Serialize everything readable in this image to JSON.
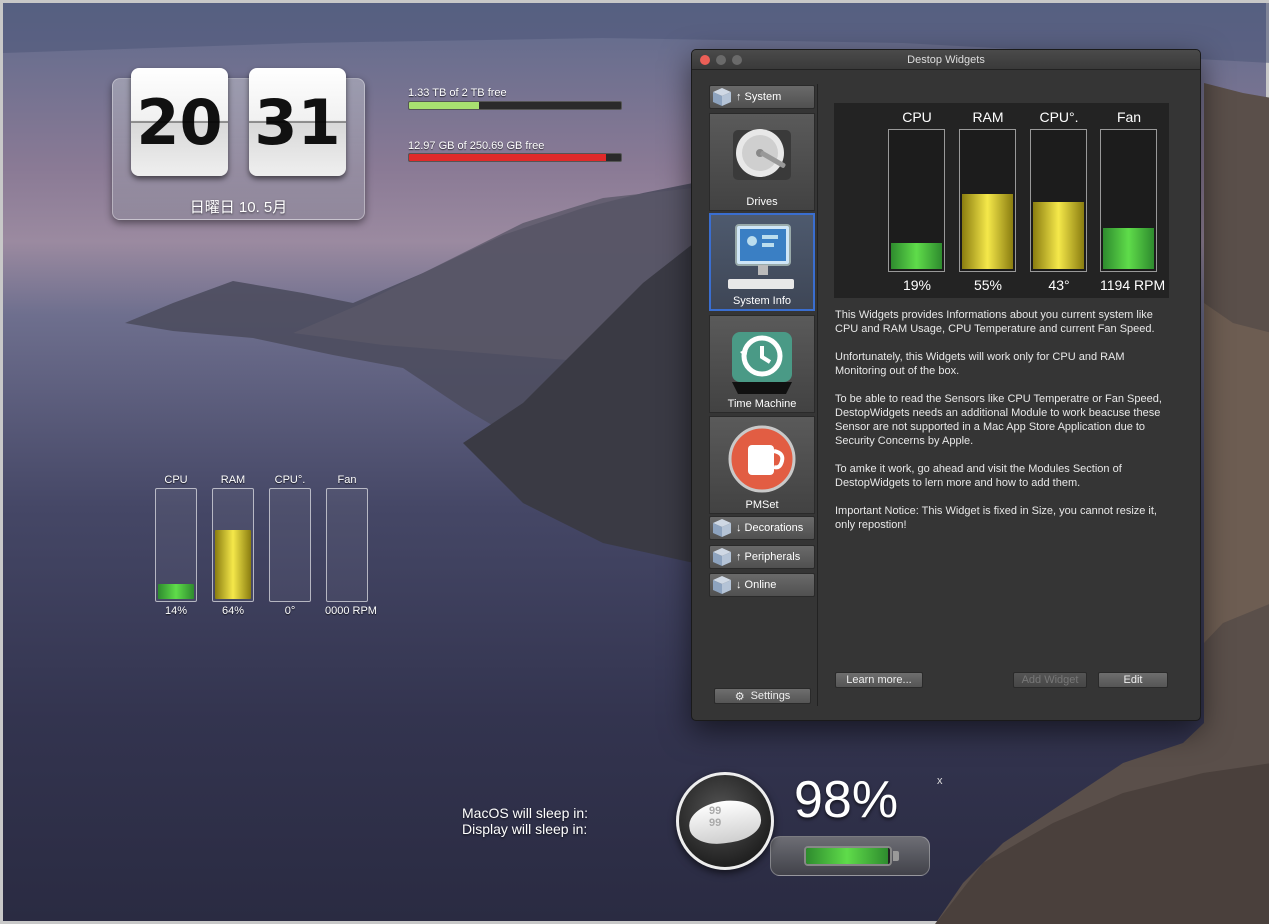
{
  "clock": {
    "hour": "20",
    "minute": "31",
    "date": "日曜日 10. 5月"
  },
  "drives": [
    {
      "label": "1.33 TB of 2 TB free",
      "fraction": 0.33,
      "color": "#a8e070"
    },
    {
      "label": "12.97 GB of 250.69 GB free",
      "fraction": 0.93,
      "color": "#e02a2a"
    }
  ],
  "desktop_widget": {
    "columns": [
      {
        "title": "CPU",
        "value": "14%",
        "level": 0.14,
        "style": "green"
      },
      {
        "title": "RAM",
        "value": "64%",
        "level": 0.64,
        "style": "yellow"
      },
      {
        "title": "CPU°.",
        "value": "0°",
        "level": 0,
        "style": "yellow"
      },
      {
        "title": "Fan",
        "value": "0000 RPM",
        "level": 0,
        "style": "green"
      }
    ]
  },
  "sleep": {
    "macos_label": "MacOS will sleep in:",
    "display_label": "Display will sleep in:"
  },
  "battery": {
    "percent": "98%",
    "level": 0.98,
    "close_label": "x",
    "mouse_digits_top": "99",
    "mouse_digits_bottom": "99"
  },
  "window": {
    "title": "Destop Widgets",
    "sidebar": {
      "group_system": "↑ System",
      "tiles": [
        {
          "label": "Drives",
          "icon": "hard-drive-icon"
        },
        {
          "label": "System Info",
          "icon": "system-info-icon"
        },
        {
          "label": "Time Machine",
          "icon": "time-machine-icon"
        },
        {
          "label": "PMSet",
          "icon": "coffee-cup-icon"
        }
      ],
      "group_decorations": "↓ Decorations",
      "group_peripherals": "↑ Peripherals",
      "group_online": "↓ Online",
      "settings": "Settings"
    },
    "preview": {
      "columns": [
        {
          "title": "CPU",
          "value": "19%",
          "level": 0.19,
          "style": "green"
        },
        {
          "title": "RAM",
          "value": "55%",
          "level": 0.55,
          "style": "yellow"
        },
        {
          "title": "CPU°.",
          "value": "43°",
          "level": 0.49,
          "style": "yellow"
        },
        {
          "title": "Fan",
          "value": "1194 RPM",
          "level": 0.3,
          "style": "green"
        }
      ]
    },
    "description": [
      "This Widgets provides Informations about you current system like CPU and RAM Usage, CPU Temperature and current Fan Speed.",
      "Unfortunately, this Widgets will work only for CPU and RAM Monitoring out of the box.",
      "To be able to read the Sensors like CPU Temperatre or Fan Speed, DestopWidgets needs an additional Module to work beacuse these Sensor are not supported in a Mac App Store Application due to Security Concerns by Apple.",
      "To amke it work, go ahead and visit the Modules Section of DestopWidgets to lern more and how to add them.",
      "Important Notice: This Widget is fixed in Size, you cannot resize it, only repostion!"
    ],
    "buttons": {
      "learn_more": "Learn more...",
      "add_widget": "Add Widget",
      "edit": "Edit"
    }
  }
}
